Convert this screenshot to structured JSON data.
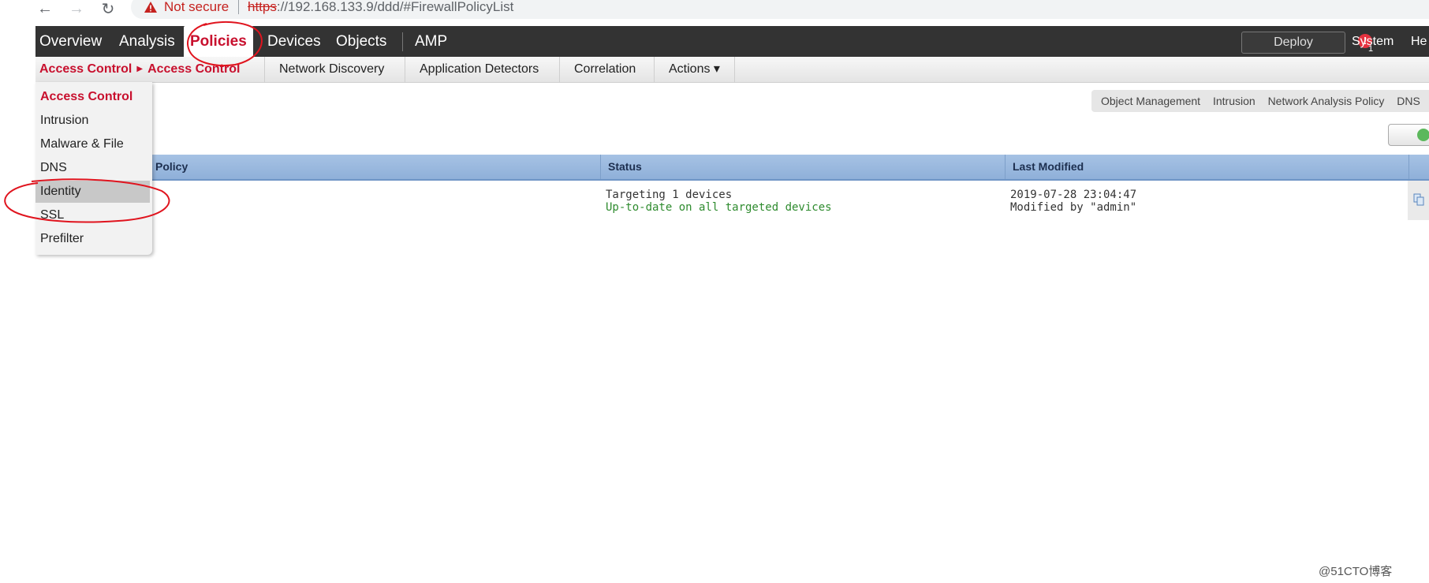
{
  "browser": {
    "security_label": "Not secure",
    "url_scheme": "https",
    "url_rest": "://192.168.133.9/ddd/#FirewallPolicyList"
  },
  "main_nav": {
    "items": [
      "Overview",
      "Analysis",
      "Policies",
      "Devices",
      "Objects",
      "AMP"
    ],
    "active": "Policies",
    "deploy_label": "Deploy",
    "alert_count": "1",
    "system_label": "System",
    "help_label": "He"
  },
  "sub_nav": {
    "breadcrumb": [
      "Access Control",
      "Access Control"
    ],
    "tabs": [
      "Network Discovery",
      "Application Detectors",
      "Correlation",
      "Actions ▾"
    ]
  },
  "dropdown": {
    "items": [
      "Access Control",
      "Intrusion",
      "Malware & File",
      "DNS",
      "Identity",
      "SSL",
      "Prefilter"
    ],
    "current": "Access Control",
    "hovered": "Identity"
  },
  "secondary_toolbar": {
    "links": [
      "Object Management",
      "Intrusion",
      "Network Analysis Policy",
      "DNS"
    ]
  },
  "table": {
    "columns": [
      "Policy",
      "Status",
      "Last Modified"
    ],
    "rows": [
      {
        "policy": "",
        "status_line1": "Targeting 1 devices",
        "status_line2": "Up-to-date on all targeted devices",
        "modified_line1": "2019-07-28 23:04:47",
        "modified_line2": "Modified by \"admin\""
      }
    ]
  },
  "watermark": "@51CTO博客",
  "colors": {
    "brand_red": "#c8102e",
    "nav_bg": "#333333",
    "table_header": "#8fb0d9",
    "status_ok": "#2e8b2e",
    "annotation": "#e0141e"
  }
}
